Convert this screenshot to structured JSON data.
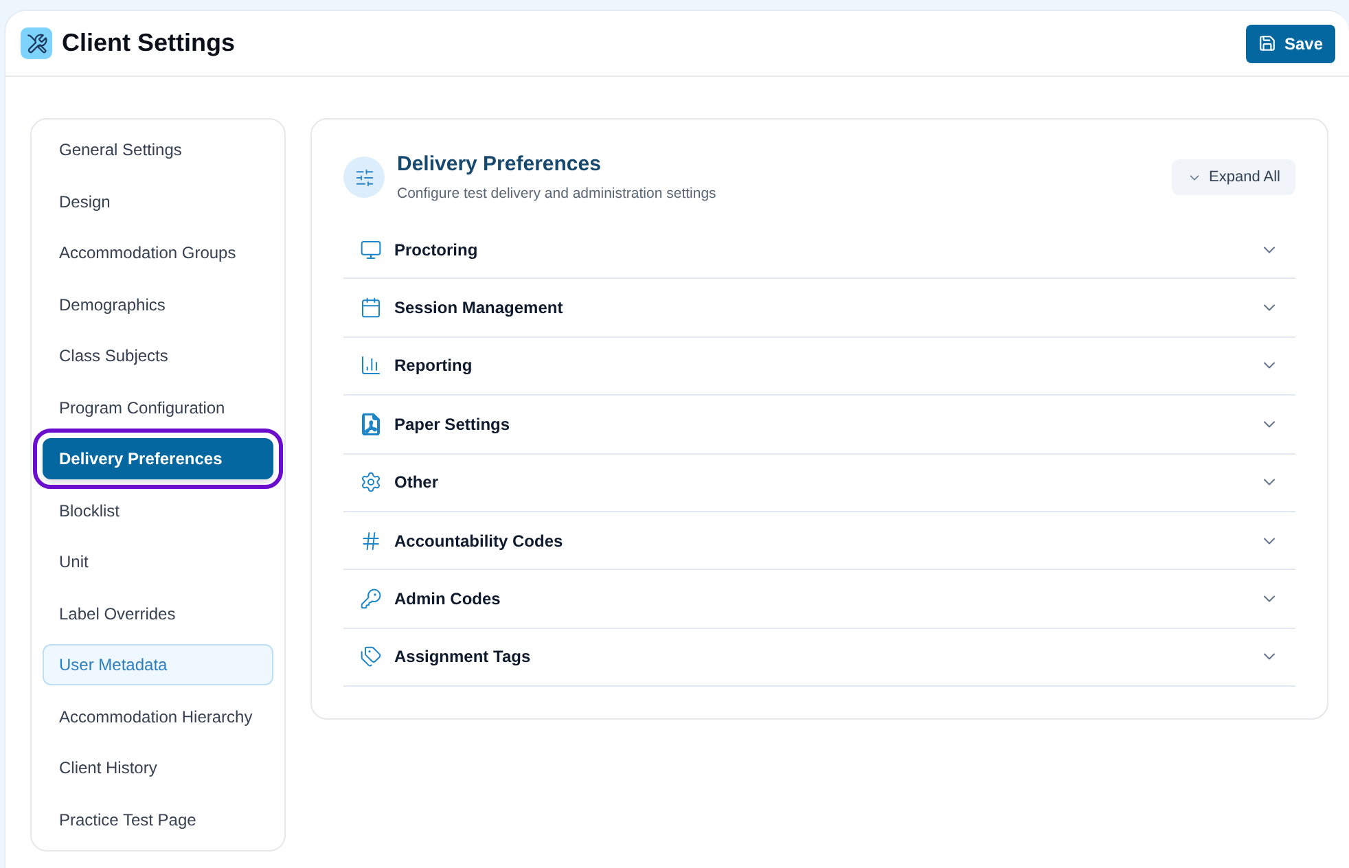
{
  "header": {
    "title": "Client Settings",
    "save_button": "Save"
  },
  "sidebar": {
    "items": [
      {
        "label": "General Settings",
        "selected": false,
        "highlighted": false
      },
      {
        "label": "Design",
        "selected": false,
        "highlighted": false
      },
      {
        "label": "Accommodation Groups",
        "selected": false,
        "highlighted": false
      },
      {
        "label": "Demographics",
        "selected": false,
        "highlighted": false
      },
      {
        "label": "Class Subjects",
        "selected": false,
        "highlighted": false
      },
      {
        "label": "Program Configuration",
        "selected": false,
        "highlighted": false
      },
      {
        "label": "Delivery Preferences",
        "selected": true,
        "highlighted": false
      },
      {
        "label": "Blocklist",
        "selected": false,
        "highlighted": false
      },
      {
        "label": "Unit",
        "selected": false,
        "highlighted": false
      },
      {
        "label": "Label Overrides",
        "selected": false,
        "highlighted": false
      },
      {
        "label": "User Metadata",
        "selected": false,
        "highlighted": true
      },
      {
        "label": "Accommodation Hierarchy",
        "selected": false,
        "highlighted": false
      },
      {
        "label": "Client History",
        "selected": false,
        "highlighted": false
      },
      {
        "label": "Practice Test Page",
        "selected": false,
        "highlighted": false
      }
    ]
  },
  "section": {
    "title": "Delivery Preferences",
    "subtitle": "Configure test delivery and administration settings",
    "expand_all_button": "Expand All",
    "panels": [
      {
        "title": "Proctoring",
        "expanded": false
      },
      {
        "title": "Session Management",
        "expanded": false
      },
      {
        "title": "Reporting",
        "expanded": false
      },
      {
        "title": "Paper Settings",
        "expanded": false
      },
      {
        "title": "Other",
        "expanded": false
      },
      {
        "title": "Accountability Codes",
        "expanded": false
      },
      {
        "title": "Admin Codes",
        "expanded": false
      },
      {
        "title": "Assignment Tags",
        "expanded": false
      }
    ]
  }
}
